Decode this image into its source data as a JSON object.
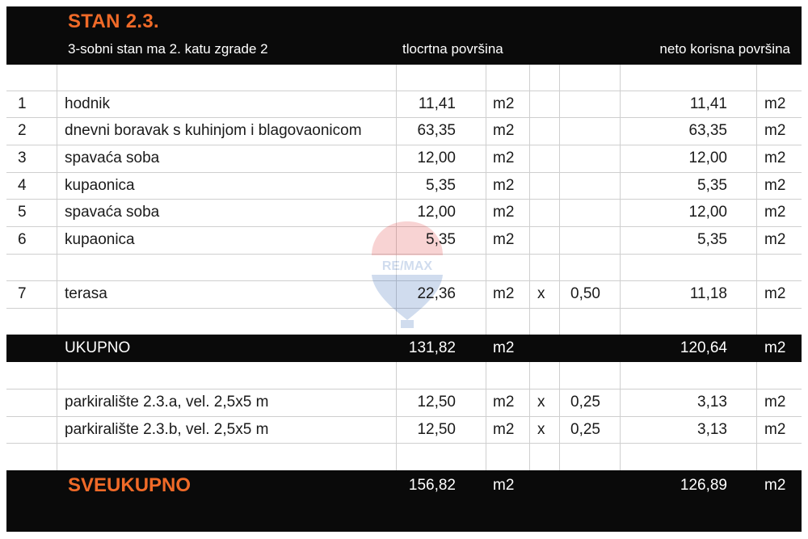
{
  "header": {
    "title": "STAN 2.3.",
    "subtitle": "3-sobni stan ma 2. katu zgrade 2",
    "col_floor_area": "tlocrtna površina",
    "col_net_area": "neto korisna površina"
  },
  "rows": [
    {
      "no": "1",
      "name": "hodnik",
      "area": "11,41",
      "unit": "m2",
      "mult": "",
      "factor": "",
      "net": "11,41",
      "net_unit": "m2"
    },
    {
      "no": "2",
      "name": "dnevni boravak s kuhinjom i blagovaonicom",
      "area": "63,35",
      "unit": "m2",
      "mult": "",
      "factor": "",
      "net": "63,35",
      "net_unit": "m2"
    },
    {
      "no": "3",
      "name": "spavaća soba",
      "area": "12,00",
      "unit": "m2",
      "mult": "",
      "factor": "",
      "net": "12,00",
      "net_unit": "m2"
    },
    {
      "no": "4",
      "name": "kupaonica",
      "area": "5,35",
      "unit": "m2",
      "mult": "",
      "factor": "",
      "net": "5,35",
      "net_unit": "m2"
    },
    {
      "no": "5",
      "name": "spavaća soba",
      "area": "12,00",
      "unit": "m2",
      "mult": "",
      "factor": "",
      "net": "12,00",
      "net_unit": "m2"
    },
    {
      "no": "6",
      "name": "kupaonica",
      "area": "5,35",
      "unit": "m2",
      "mult": "",
      "factor": "",
      "net": "5,35",
      "net_unit": "m2"
    },
    {
      "no": "7",
      "name": "terasa",
      "area": "22,36",
      "unit": "m2",
      "mult": "x",
      "factor": "0,50",
      "net": "11,18",
      "net_unit": "m2"
    }
  ],
  "ukupno": {
    "label": "UKUPNO",
    "area": "131,82",
    "unit": "m2",
    "net": "120,64",
    "net_unit": "m2"
  },
  "parking": [
    {
      "name": "parkiralište 2.3.a, vel. 2,5x5 m",
      "area": "12,50",
      "unit": "m2",
      "mult": "x",
      "factor": "0,25",
      "net": "3,13",
      "net_unit": "m2"
    },
    {
      "name": "parkiralište 2.3.b, vel. 2,5x5 m",
      "area": "12,50",
      "unit": "m2",
      "mult": "x",
      "factor": "0,25",
      "net": "3,13",
      "net_unit": "m2"
    }
  ],
  "sveukupno": {
    "label": "SVEUKUPNO",
    "area": "156,82",
    "unit": "m2",
    "net": "126,89",
    "net_unit": "m2"
  },
  "watermark": {
    "text": "RE/MAX",
    "icon": "remax-balloon-icon"
  },
  "colors": {
    "accent": "#f06a28",
    "band": "#0a0a0a",
    "grid": "#cfcfcf",
    "text": "#1a1a1a"
  }
}
